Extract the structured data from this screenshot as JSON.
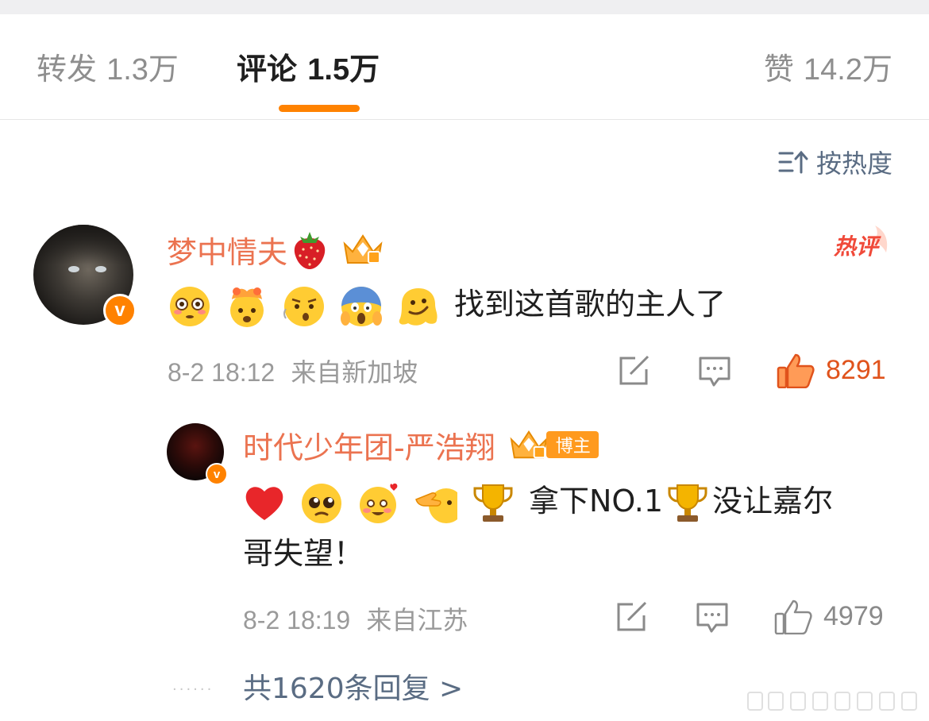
{
  "tabs": {
    "repost": {
      "label": "转发",
      "count": "1.3万"
    },
    "comment": {
      "label": "评论",
      "count": "1.5万"
    },
    "like": {
      "label": "赞",
      "count": "14.2万"
    }
  },
  "sort": {
    "label": "按热度"
  },
  "comment": {
    "username": "梦中情夫",
    "hot_tag": "热评",
    "text": "找到这首歌的主人了",
    "emojis": [
      "flushed-face",
      "exploding-head",
      "hushed-face",
      "screaming-face",
      "melting-face"
    ],
    "time": "8-2 18:12",
    "location": "来自新加坡",
    "likes": "8291"
  },
  "reply": {
    "username": "时代少年团-严浩翔",
    "badge": "博主",
    "emojis": [
      "red-heart",
      "pleading-face",
      "smiling-hearts-face",
      "pointing-face",
      "trophy"
    ],
    "text_a": "拿下NO.1",
    "text_b": "没让嘉尔",
    "text_c": "哥失望！",
    "time": "8-2 18:19",
    "location": "来自江苏",
    "likes": "4979"
  },
  "replies_link": "共1620条回复 >",
  "colors": {
    "accent": "#ff8200",
    "username": "#eb7350",
    "link": "#5a6c83",
    "meta": "#9a9a9a"
  }
}
